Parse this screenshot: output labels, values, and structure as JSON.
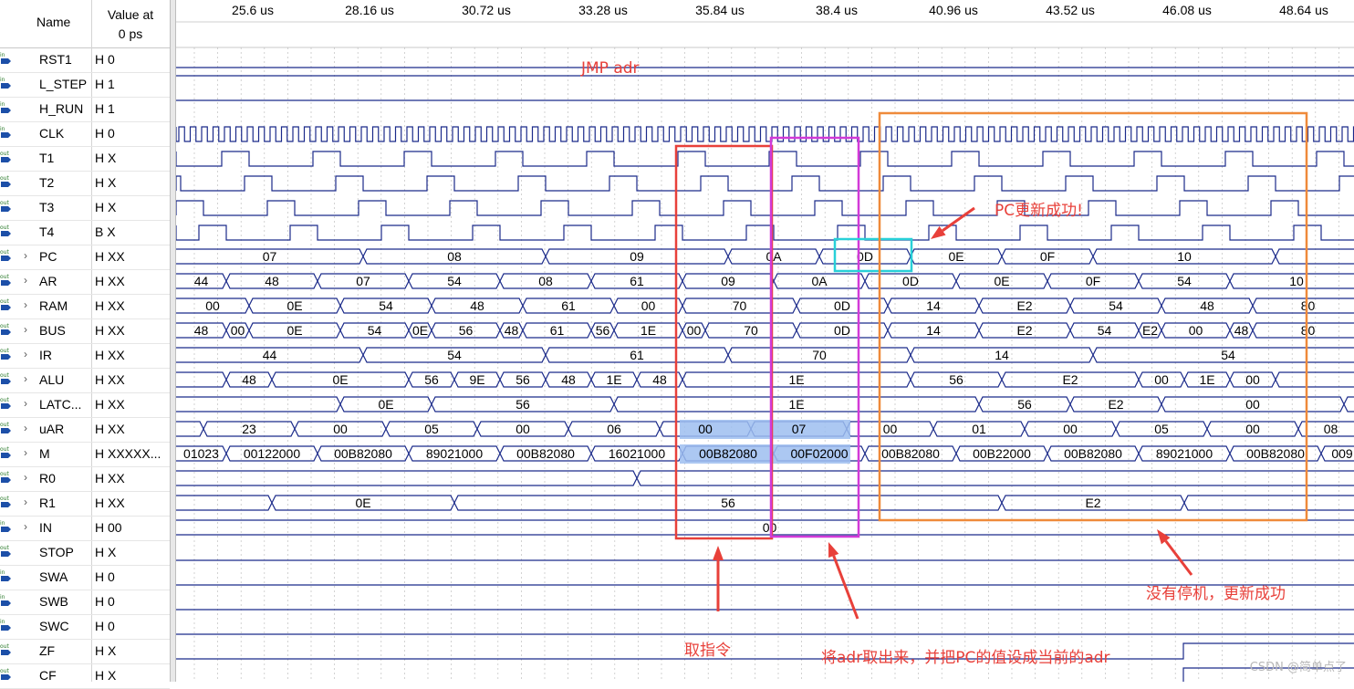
{
  "header": {
    "name_label": "Name",
    "value_label": "Value at\n0 ps"
  },
  "time_ticks": [
    "25.6 us",
    "28.16 us",
    "30.72 us",
    "33.28 us",
    "35.84 us",
    "38.4 us",
    "40.96 us",
    "43.52 us",
    "46.08 us",
    "48.64 us"
  ],
  "signals": [
    {
      "name": "RST1",
      "value": "H 0",
      "kind": "in",
      "expand": false
    },
    {
      "name": "L_STEP",
      "value": "H 1",
      "kind": "in",
      "expand": false
    },
    {
      "name": "H_RUN",
      "value": "H 1",
      "kind": "in",
      "expand": false
    },
    {
      "name": "CLK",
      "value": "H 0",
      "kind": "in",
      "expand": false
    },
    {
      "name": "T1",
      "value": "H X",
      "kind": "out",
      "expand": false
    },
    {
      "name": "T2",
      "value": "H X",
      "kind": "out",
      "expand": false
    },
    {
      "name": "T3",
      "value": "H X",
      "kind": "out",
      "expand": false
    },
    {
      "name": "T4",
      "value": "B X",
      "kind": "out",
      "expand": false
    },
    {
      "name": "PC",
      "value": "H XX",
      "kind": "out",
      "expand": true
    },
    {
      "name": "AR",
      "value": "H XX",
      "kind": "out",
      "expand": true
    },
    {
      "name": "RAM",
      "value": "H XX",
      "kind": "out",
      "expand": true
    },
    {
      "name": "BUS",
      "value": "H XX",
      "kind": "out",
      "expand": true
    },
    {
      "name": "IR",
      "value": "H XX",
      "kind": "out",
      "expand": true
    },
    {
      "name": "ALU",
      "value": "H XX",
      "kind": "out",
      "expand": true
    },
    {
      "name": "LATC...",
      "value": "H XX",
      "kind": "out",
      "expand": true
    },
    {
      "name": "uAR",
      "value": "H XX",
      "kind": "out",
      "expand": true
    },
    {
      "name": "M",
      "value": "H XXXXX...",
      "kind": "out",
      "expand": true
    },
    {
      "name": "R0",
      "value": "H XX",
      "kind": "out",
      "expand": true
    },
    {
      "name": "R1",
      "value": "H XX",
      "kind": "out",
      "expand": true
    },
    {
      "name": "IN",
      "value": "H 00",
      "kind": "in",
      "expand": true
    },
    {
      "name": "STOP",
      "value": "H X",
      "kind": "out",
      "expand": false
    },
    {
      "name": "SWA",
      "value": "H 0",
      "kind": "in",
      "expand": false
    },
    {
      "name": "SWB",
      "value": "H 0",
      "kind": "in",
      "expand": false
    },
    {
      "name": "SWC",
      "value": "H 0",
      "kind": "in",
      "expand": false
    },
    {
      "name": "ZF",
      "value": "H X",
      "kind": "out",
      "expand": false
    },
    {
      "name": "CF",
      "value": "H X",
      "kind": "out",
      "expand": false
    }
  ],
  "bus_segments": {
    "PC": [
      [
        0,
        "07"
      ],
      [
        205,
        "08"
      ],
      [
        405,
        "09"
      ],
      [
        605,
        "0A"
      ],
      [
        705,
        "0D"
      ],
      [
        805,
        "0E"
      ],
      [
        905,
        "0F"
      ],
      [
        1005,
        "10"
      ],
      [
        1205,
        ""
      ]
    ],
    "AR": [
      [
        0,
        "44"
      ],
      [
        55,
        "48"
      ],
      [
        155,
        "07"
      ],
      [
        255,
        "54"
      ],
      [
        355,
        "08"
      ],
      [
        455,
        "61"
      ],
      [
        555,
        "09"
      ],
      [
        655,
        "0A"
      ],
      [
        755,
        "0D"
      ],
      [
        855,
        "0E"
      ],
      [
        955,
        "0F"
      ],
      [
        1055,
        "54"
      ],
      [
        1155,
        "10"
      ]
    ],
    "RAM": [
      [
        0,
        "00"
      ],
      [
        80,
        "0E"
      ],
      [
        180,
        "54"
      ],
      [
        280,
        "48"
      ],
      [
        380,
        "61"
      ],
      [
        480,
        "00"
      ],
      [
        555,
        "70"
      ],
      [
        680,
        "0D"
      ],
      [
        780,
        "14"
      ],
      [
        880,
        "E2"
      ],
      [
        980,
        "54"
      ],
      [
        1080,
        "48"
      ],
      [
        1180,
        "80"
      ]
    ],
    "BUS": [
      [
        0,
        "48"
      ],
      [
        55,
        "00"
      ],
      [
        80,
        "0E"
      ],
      [
        180,
        "54"
      ],
      [
        255,
        "0E"
      ],
      [
        280,
        "56"
      ],
      [
        355,
        "48"
      ],
      [
        380,
        "61"
      ],
      [
        455,
        "56"
      ],
      [
        480,
        "1E"
      ],
      [
        555,
        "00"
      ],
      [
        580,
        "70"
      ],
      [
        680,
        "0D"
      ],
      [
        780,
        "14"
      ],
      [
        880,
        "E2"
      ],
      [
        980,
        "54"
      ],
      [
        1055,
        "E2"
      ],
      [
        1080,
        "00"
      ],
      [
        1155,
        "48"
      ],
      [
        1180,
        "80"
      ]
    ],
    "IR": [
      [
        0,
        "44"
      ],
      [
        205,
        "54"
      ],
      [
        405,
        "61"
      ],
      [
        605,
        "70"
      ],
      [
        805,
        "14"
      ],
      [
        1005,
        "54"
      ]
    ],
    "ALU": [
      [
        0,
        ""
      ],
      [
        55,
        "48"
      ],
      [
        105,
        "0E"
      ],
      [
        255,
        "56"
      ],
      [
        305,
        "9E"
      ],
      [
        355,
        "56"
      ],
      [
        405,
        "48"
      ],
      [
        455,
        "1E"
      ],
      [
        505,
        "48"
      ],
      [
        555,
        "1E"
      ],
      [
        805,
        "56"
      ],
      [
        905,
        "E2"
      ],
      [
        1055,
        "00"
      ],
      [
        1105,
        "1E"
      ],
      [
        1155,
        "00"
      ],
      [
        1205,
        ""
      ]
    ],
    "LATC": [
      [
        0,
        ""
      ],
      [
        180,
        "0E"
      ],
      [
        280,
        "56"
      ],
      [
        480,
        "1E"
      ],
      [
        880,
        "56"
      ],
      [
        980,
        "E2"
      ],
      [
        1080,
        "00"
      ],
      [
        1280,
        ""
      ]
    ],
    "uAR": [
      [
        0,
        ""
      ],
      [
        30,
        "23"
      ],
      [
        130,
        "00"
      ],
      [
        230,
        "05"
      ],
      [
        330,
        "00"
      ],
      [
        430,
        "06"
      ],
      [
        530,
        "00"
      ],
      [
        630,
        "07"
      ],
      [
        735,
        "00"
      ],
      [
        830,
        "01"
      ],
      [
        930,
        "00"
      ],
      [
        1030,
        "05"
      ],
      [
        1130,
        "00"
      ],
      [
        1230,
        "08"
      ]
    ],
    "M": [
      [
        0,
        "01023"
      ],
      [
        55,
        "00122000"
      ],
      [
        155,
        "00B82080"
      ],
      [
        255,
        "89021000"
      ],
      [
        355,
        "00B82080"
      ],
      [
        455,
        "16021000"
      ],
      [
        555,
        "00B82080"
      ],
      [
        655,
        "00F02000"
      ],
      [
        755,
        "00B82080"
      ],
      [
        855,
        "00B22000"
      ],
      [
        955,
        "00B82080"
      ],
      [
        1055,
        "89021000"
      ],
      [
        1155,
        "00B82080"
      ],
      [
        1255,
        "009"
      ]
    ],
    "R0": [
      [
        0,
        ""
      ],
      [
        505,
        ""
      ]
    ],
    "R1": [
      [
        0,
        ""
      ],
      [
        105,
        "0E"
      ],
      [
        305,
        "56"
      ],
      [
        905,
        "E2"
      ],
      [
        1105,
        ""
      ]
    ],
    "IN": [
      [
        0,
        "00"
      ]
    ]
  },
  "annotations": {
    "jmp": "JMP adr",
    "pc_updated": "PC更新成功!",
    "fetch": "取指令",
    "load_adr": "将adr取出来，并把PC的值设成当前的adr",
    "no_halt": "没有停机，更新成功"
  },
  "colors": {
    "wave": "#1b2a8a",
    "highlight": "#9dbef0",
    "box_fetch": "#e8403a",
    "box_load": "#d23ad8",
    "box_pc": "#28d0d8",
    "box_run": "#ef8a3a",
    "arrow": "#e8403a",
    "grid": "#c0c0c0"
  },
  "watermark": "CSDN @简单点了"
}
